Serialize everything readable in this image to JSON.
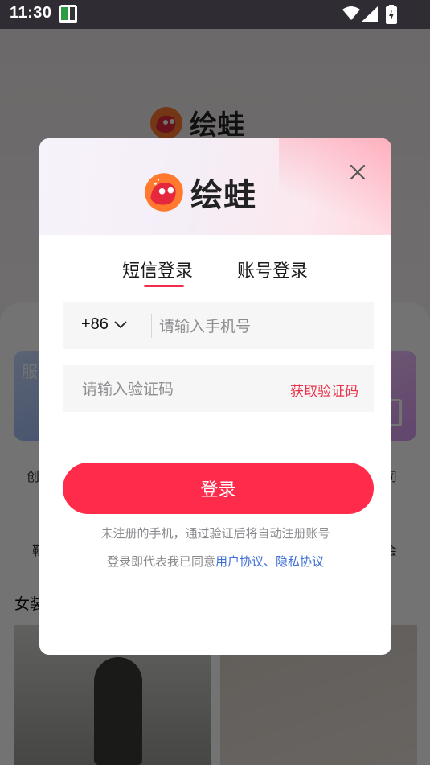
{
  "status_bar": {
    "time": "11:30",
    "icons": [
      "notification-app-icon",
      "wifi-icon",
      "signal-icon",
      "battery-charging-icon"
    ]
  },
  "background": {
    "app_name": "绘蛙",
    "card_left_label": "服",
    "chips": [
      "创",
      "司",
      "鞋",
      "会"
    ],
    "section_title": "女装"
  },
  "dialog": {
    "app_name": "绘蛙",
    "close_icon": "close-icon",
    "tabs": [
      {
        "label": "短信登录",
        "active": true
      },
      {
        "label": "账号登录",
        "active": false
      }
    ],
    "phone": {
      "country_code": "+86",
      "placeholder": "请输入手机号",
      "value": ""
    },
    "verification": {
      "placeholder": "请输入验证码",
      "value": "",
      "get_code_label": "获取验证码"
    },
    "login_label": "登录",
    "notice": "未注册的手机，通过验证后将自动注册账号",
    "agreement": {
      "prefix": "登录即代表我已同意",
      "user_agreement": "用户协议",
      "separator": "、",
      "privacy_policy": "隐私协议"
    },
    "colors": {
      "accent": "#ff2b4b",
      "link": "#3d6fd6",
      "tab_indicator": "#f02d4a"
    }
  }
}
